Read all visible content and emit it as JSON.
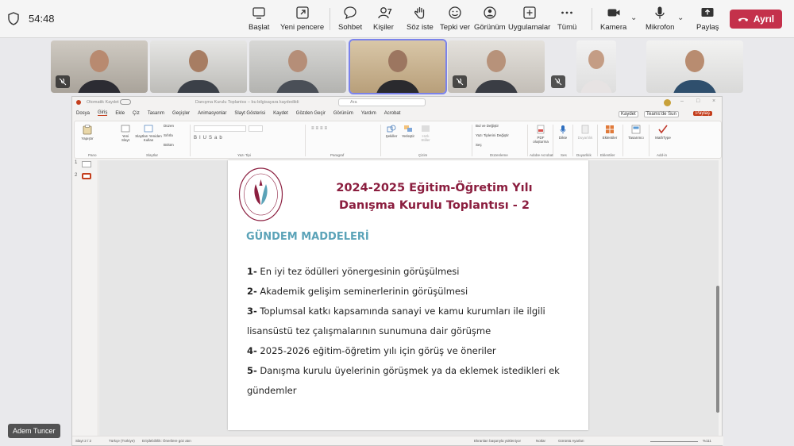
{
  "meeting": {
    "timer": "54:48",
    "participant_count": "7",
    "buttons": {
      "start": "Başlat",
      "new_window": "Yeni pencere",
      "chat": "Sohbet",
      "people": "Kişiler",
      "raise": "Söz iste",
      "react": "Tepki ver",
      "view": "Görünüm",
      "apps": "Uygulamalar",
      "more": "Tümü",
      "camera": "Kamera",
      "mic": "Mikrofon",
      "share": "Paylaş",
      "leave": "Ayrıl"
    },
    "presenter_name": "Adem Tuncer",
    "colors": {
      "leave": "#c4314b",
      "accent": "#7b83eb"
    }
  },
  "ppt": {
    "autosave": "Otomatik Kaydet",
    "title": "Danışma Kurulu Toplantısı – bu bilgisayara kaydedildi",
    "search": "Ara",
    "menu": [
      "Dosya",
      "Giriş",
      "Ekle",
      "Çiz",
      "Tasarım",
      "Geçişler",
      "Animasyonlar",
      "Slayt Gösterisi",
      "Kaydet",
      "Gözden Geçir",
      "Görünüm",
      "Yardım",
      "Acrobat"
    ],
    "top_right": {
      "record": "Kaydet",
      "teams": "Teams'de Sun",
      "share": "Paylaş"
    },
    "ribbon_groups": [
      "Pano",
      "Slaytlar",
      "Yazı Tipi",
      "Paragraf",
      "Çizim",
      "Düzenleme",
      "Adobe Acrobat",
      "Ses",
      "Duyarlılık",
      "Eklentiler",
      "Add-in"
    ],
    "ribbon_buttons": {
      "paste": "Yapıştır",
      "new_slide": "Yeni Slayt",
      "reuse": "Slaytları Yeniden Kullan",
      "layout": "Düzen",
      "reset": "Sıfırla",
      "section": "Bölüm",
      "shapes": "Şekiller",
      "arrange": "Yerleştir",
      "quick_styles": "Hızlı Stiller",
      "find": "Bul ve Değiştir",
      "replace_fonts": "Yazı Tiplerini Değiştir",
      "select": "Seç",
      "pdf": "PDF oluşturma",
      "dictate": "Dikte",
      "sensitivity": "Duyarlılık",
      "addins": "Eklentiler",
      "designer": "Tasarımcı",
      "mathtype": "MathType"
    },
    "thumb_numbers": [
      "1",
      "2"
    ],
    "status": {
      "slide": "Slayt 2 / 2",
      "lang": "Türkçe (Türkiye)",
      "accessibility": "Erişilebilirlik: Önerilere göz atın",
      "notes": "Notlar",
      "display": "Görüntü Ayarları",
      "zoom": "%111",
      "share_notice": "Ekranları başarıyla yükleniyor"
    }
  },
  "slide": {
    "logo_text": "YALOVA ÜNİVERSİTESİ",
    "logo_year": "2008",
    "title_line1": "2024-2025 Eğitim-Öğretim Yılı",
    "title_line2": "Danışma Kurulu Toplantısı - 2",
    "agenda_heading": "GÜNDEM MADDELERİ",
    "items": [
      {
        "num": "1-",
        "text": " En iyi tez ödülleri yönergesinin görüşülmesi"
      },
      {
        "num": "2-",
        "text": " Akademik gelişim seminerlerinin görüşülmesi"
      },
      {
        "num": "3-",
        "text": " Toplumsal katkı kapsamında sanayi ve kamu kurumları ile ilgili"
      },
      {
        "num": "",
        "text": "lisansüstü tez çalışmalarının sunumuna dair görüşme"
      },
      {
        "num": "4-",
        "text": " 2025-2026 eğitim-öğretim yılı için görüş ve öneriler"
      },
      {
        "num": "5-",
        "text": " Danışma kurulu üyelerinin görüşmek ya da eklemek istedikleri ek"
      },
      {
        "num": "",
        "text": "gündemler"
      }
    ]
  }
}
